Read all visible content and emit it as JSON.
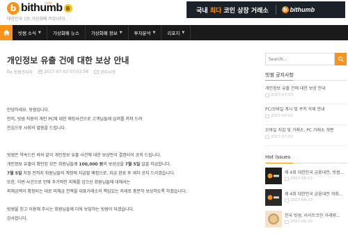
{
  "header": {
    "logo_text": "bithumb",
    "logo_cafe": "cafe",
    "logo_mark": "b",
    "logo_coin": "B",
    "tagline": "대한민국 1등 가상화폐 커뮤니티!"
  },
  "banner": {
    "text_before": "국내 ",
    "text_highlight": "최다",
    "text_after": " 코인 상장 거래소",
    "brand": "bithumb",
    "brand_mark": "b"
  },
  "nav": {
    "home_icon": "home-icon",
    "items": [
      {
        "label": "빗썸 소식",
        "has_dropdown": true
      },
      {
        "label": "가상화폐 뉴스",
        "has_dropdown": false
      },
      {
        "label": "가상화폐 정보",
        "has_dropdown": true
      },
      {
        "label": "투자분석",
        "has_dropdown": true
      },
      {
        "label": "리포지",
        "has_dropdown": true
      }
    ]
  },
  "post": {
    "title": "개인정보 유출 건에 대한 보상 안내",
    "author_prefix": "By",
    "author": "빗썸관리자",
    "datetime": "2017-07-03 07:03:58",
    "category": "공지사항",
    "paragraphs": [
      [
        "안녕하세요. 빗썸입니다.",
        "먼저, 빗썸 직원의 개인 PC에 대한 해킹사건으로 고객님들께 심려를 끼쳐 드려",
        "진심으로 사죄의 말씀을 드립니다."
      ],
      [
        "빗썸은 약속드린 바와 같이 개인정보 유출 사건에 대한 보상안이 결정되어 공지 드립니다.",
        "개인정보 유출이 확인된 모든 회원님들께 100,000 원의 보상금을 7월 5일 일괄 지급합니다.",
        "7월 5일 자정 전까지 회원님들의 계정에 지급할 예정으로, 지급 완료 후 재차 공지 드리겠습니다.",
        "또한, 이번 사건으로 인해 추가적인 피해를 입으신 회원님들에 대해서는",
        "피해금액이 확정되는 대로 피해금 전액을 대표거래소의 책임있는 자세로 충분히 보상하도록 하겠습니다."
      ],
      [
        "빗썸을 믿고 이용해 주시는 회원님들께 더욱 보답하는 빗썸이 되겠습니다.",
        "감사합니다."
      ]
    ],
    "bold_amount": "100,000 원",
    "bold_date": "7월 5일"
  },
  "sidebar": {
    "search_placeholder": "Search...",
    "notice_title": "빗썸 공지사항",
    "notices": [
      {
        "title": "개인정보 유출 건에 대한 보상 안내",
        "date": "2017-07-03"
      },
      {
        "title": "PC/모바일 계시 및 쿠키 삭제 안내",
        "date": "2017-07-03"
      },
      {
        "title": "오바일 지갑 및 거래소, PC 거래소 개편",
        "date": "2017-07-02"
      }
    ],
    "hot_title": "Hot Issues",
    "hot": [
      {
        "title": "제 4회 대한민국 금융대전, 빗썸...",
        "date": "2017-06-23",
        "thumb": "bithumb-logo-thumb"
      },
      {
        "title": "제 4회 대한민국 금융대전 개최...",
        "date": "2017-06-23",
        "thumb": "bithumb-logo-thumb"
      },
      {
        "title": "한국 빗썸, 라이트코인 거래량...",
        "date": "2017-06-20",
        "thumb": "litecoin-thumb"
      }
    ]
  },
  "colors": {
    "accent": "#f7931a",
    "nav_bg": "#1a1a1a",
    "banner_bg": "#1b2129"
  }
}
